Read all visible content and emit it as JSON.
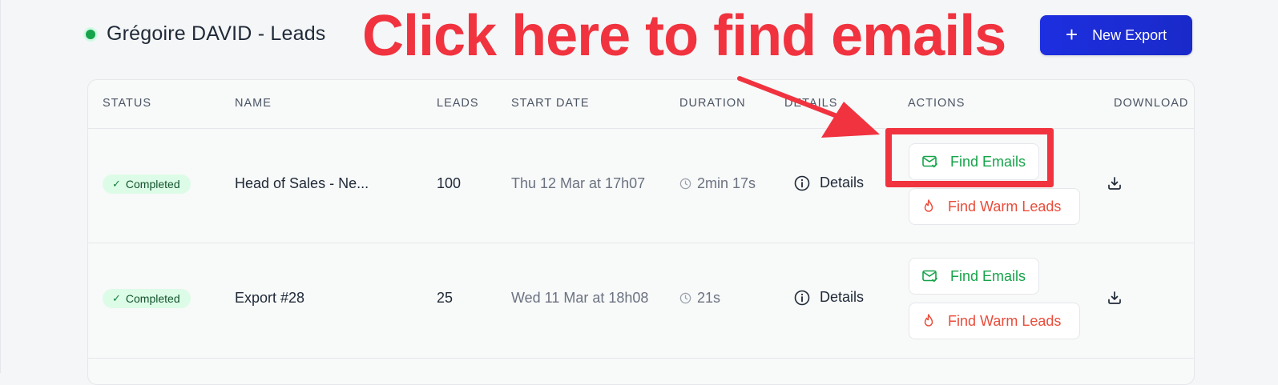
{
  "header": {
    "title": "Grégoire DAVID - Leads",
    "new_export_label": "New Export",
    "plus_icon": "+"
  },
  "annotation": {
    "text": "Click here to find emails",
    "color": "#f0333f"
  },
  "table": {
    "columns": [
      "STATUS",
      "NAME",
      "LEADS",
      "START DATE",
      "DURATION",
      "DETAILS",
      "ACTIONS",
      "DOWNLOAD"
    ],
    "rows": [
      {
        "status": "Completed",
        "name": "Head of Sales - Ne...",
        "leads": "100",
        "start_date": "Thu 12 Mar at 17h07",
        "duration": "2min 17s",
        "details": "Details",
        "find_emails": "Find Emails",
        "find_warm_leads": "Find Warm Leads"
      },
      {
        "status": "Completed",
        "name": "Export #28",
        "leads": "25",
        "start_date": "Wed 11 Mar at 18h08",
        "duration": "21s",
        "details": "Details",
        "find_emails": "Find Emails",
        "find_warm_leads": "Find Warm Leads"
      }
    ]
  },
  "icons": {
    "status_dot": "status-dot",
    "check": "check-icon",
    "clock": "clock-icon",
    "info": "info-icon",
    "mail": "mail-check-icon",
    "flame": "flame-icon",
    "download": "download-icon"
  },
  "colors": {
    "primary": "#1d2fe0",
    "success": "#16a34a",
    "warm": "#ea4c3a",
    "badge_bg": "#dcfce7"
  }
}
